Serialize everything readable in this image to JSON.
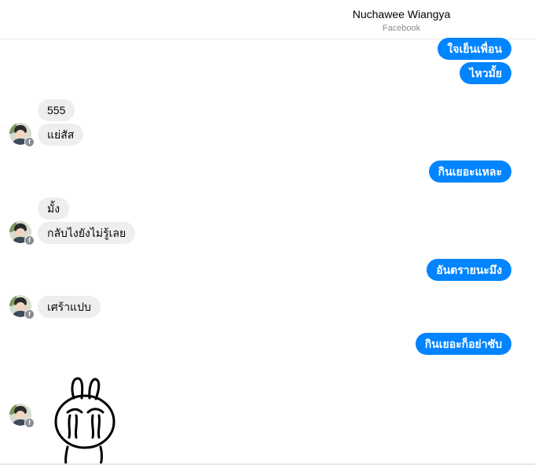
{
  "header": {
    "name": "Nuchawee Wiangya",
    "subtitle": "Facebook"
  },
  "avatar_badge": "f",
  "messages": [
    {
      "text": "ใจเย็นเพื่อน"
    },
    {
      "text": "ไหวมั้ย"
    },
    {
      "text": "555"
    },
    {
      "text": "แย่สัส"
    },
    {
      "text": "กินเยอะแหละ"
    },
    {
      "text": "มั้ง"
    },
    {
      "text": "กลับไงยังไม่รู้เลย"
    },
    {
      "text": "อันตรายนะมึง"
    },
    {
      "text": "เศร้าแปบ"
    },
    {
      "text": "กินเยอะก็อย่าซับ"
    }
  ],
  "sticker": {
    "icon": "crying-bunny-sticker"
  },
  "colors": {
    "outgoing_bubble": "#0084ff",
    "incoming_bubble": "#eeeeef",
    "text": "#050505"
  }
}
